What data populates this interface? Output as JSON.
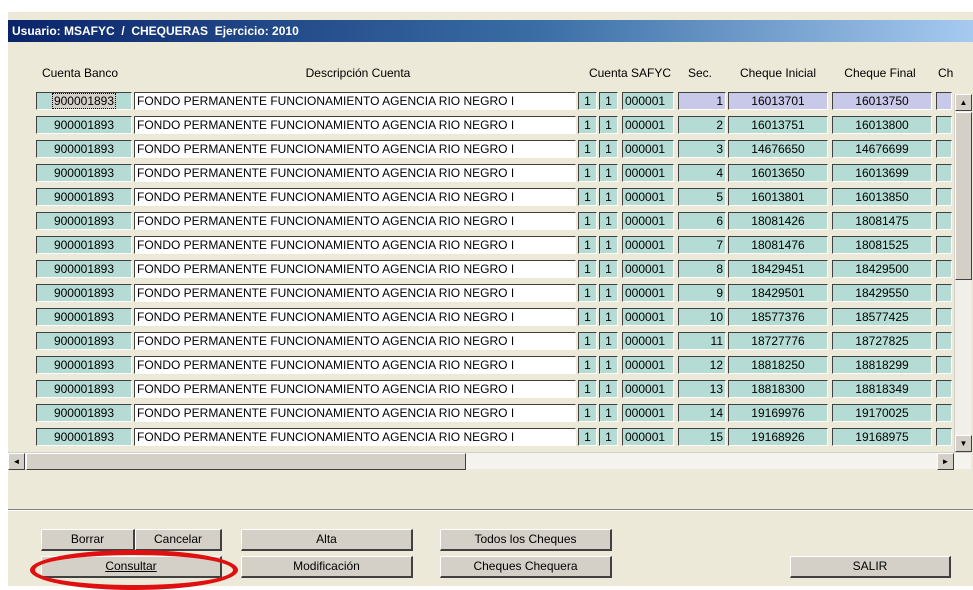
{
  "window": {
    "title": "Usuario: MSAFYC  /  CHEQUERAS  Ejercicio: 2010"
  },
  "columns": {
    "cuenta_banco": "Cuenta Banco",
    "descripcion": "Descripción Cuenta",
    "cuenta_safyc": "Cuenta SAFYC",
    "sec": "Sec.",
    "cheque_inicial": "Cheque Inicial",
    "cheque_final": "Cheque Final",
    "extra": "Ch"
  },
  "rows": [
    {
      "banco": "900001893",
      "desc": "FONDO PERMANENTE FUNCIONAMIENTO AGENCIA RIO NEGRO I",
      "n1": "1",
      "n2": "1",
      "safyc": "000001",
      "sec": "1",
      "ini": "16013701",
      "fin": "16013750"
    },
    {
      "banco": "900001893",
      "desc": "FONDO PERMANENTE FUNCIONAMIENTO AGENCIA RIO NEGRO I",
      "n1": "1",
      "n2": "1",
      "safyc": "000001",
      "sec": "2",
      "ini": "16013751",
      "fin": "16013800"
    },
    {
      "banco": "900001893",
      "desc": "FONDO PERMANENTE FUNCIONAMIENTO AGENCIA RIO NEGRO I",
      "n1": "1",
      "n2": "1",
      "safyc": "000001",
      "sec": "3",
      "ini": "14676650",
      "fin": "14676699"
    },
    {
      "banco": "900001893",
      "desc": "FONDO PERMANENTE FUNCIONAMIENTO AGENCIA RIO NEGRO I",
      "n1": "1",
      "n2": "1",
      "safyc": "000001",
      "sec": "4",
      "ini": "16013650",
      "fin": "16013699"
    },
    {
      "banco": "900001893",
      "desc": "FONDO PERMANENTE FUNCIONAMIENTO AGENCIA RIO NEGRO I",
      "n1": "1",
      "n2": "1",
      "safyc": "000001",
      "sec": "5",
      "ini": "16013801",
      "fin": "16013850"
    },
    {
      "banco": "900001893",
      "desc": "FONDO PERMANENTE FUNCIONAMIENTO AGENCIA RIO NEGRO I",
      "n1": "1",
      "n2": "1",
      "safyc": "000001",
      "sec": "6",
      "ini": "18081426",
      "fin": "18081475"
    },
    {
      "banco": "900001893",
      "desc": "FONDO PERMANENTE FUNCIONAMIENTO AGENCIA RIO NEGRO I",
      "n1": "1",
      "n2": "1",
      "safyc": "000001",
      "sec": "7",
      "ini": "18081476",
      "fin": "18081525"
    },
    {
      "banco": "900001893",
      "desc": "FONDO PERMANENTE FUNCIONAMIENTO AGENCIA RIO NEGRO I",
      "n1": "1",
      "n2": "1",
      "safyc": "000001",
      "sec": "8",
      "ini": "18429451",
      "fin": "18429500"
    },
    {
      "banco": "900001893",
      "desc": "FONDO PERMANENTE FUNCIONAMIENTO AGENCIA RIO NEGRO I",
      "n1": "1",
      "n2": "1",
      "safyc": "000001",
      "sec": "9",
      "ini": "18429501",
      "fin": "18429550"
    },
    {
      "banco": "900001893",
      "desc": "FONDO PERMANENTE FUNCIONAMIENTO AGENCIA RIO NEGRO I",
      "n1": "1",
      "n2": "1",
      "safyc": "000001",
      "sec": "10",
      "ini": "18577376",
      "fin": "18577425"
    },
    {
      "banco": "900001893",
      "desc": "FONDO PERMANENTE FUNCIONAMIENTO AGENCIA RIO NEGRO I",
      "n1": "1",
      "n2": "1",
      "safyc": "000001",
      "sec": "11",
      "ini": "18727776",
      "fin": "18727825"
    },
    {
      "banco": "900001893",
      "desc": "FONDO PERMANENTE FUNCIONAMIENTO AGENCIA RIO NEGRO I",
      "n1": "1",
      "n2": "1",
      "safyc": "000001",
      "sec": "12",
      "ini": "18818250",
      "fin": "18818299"
    },
    {
      "banco": "900001893",
      "desc": "FONDO PERMANENTE FUNCIONAMIENTO AGENCIA RIO NEGRO I",
      "n1": "1",
      "n2": "1",
      "safyc": "000001",
      "sec": "13",
      "ini": "18818300",
      "fin": "18818349"
    },
    {
      "banco": "900001893",
      "desc": "FONDO PERMANENTE FUNCIONAMIENTO AGENCIA RIO NEGRO I",
      "n1": "1",
      "n2": "1",
      "safyc": "000001",
      "sec": "14",
      "ini": "19169976",
      "fin": "19170025"
    },
    {
      "banco": "900001893",
      "desc": "FONDO PERMANENTE FUNCIONAMIENTO AGENCIA RIO NEGRO I",
      "n1": "1",
      "n2": "1",
      "safyc": "000001",
      "sec": "15",
      "ini": "19168926",
      "fin": "19168975"
    }
  ],
  "selected_row": 1,
  "scroll_icons": {
    "up": "▲",
    "down": "▼",
    "left": "◄",
    "right": "►"
  },
  "buttons": {
    "borrar": "Borrar",
    "cancelar": "Cancelar",
    "consultar": "Consultar",
    "alta": "Alta",
    "modificacion": "Modificación",
    "todos_cheques": "Todos los Cheques",
    "cheques_chequera": "Cheques Chequera",
    "salir": "SALIR"
  },
  "colors": {
    "title_start": "#0a246a",
    "title_end": "#a6caf0",
    "cell_teal": "#b5dcd4",
    "window_bg": "#ece9d8",
    "highlight_red": "#e01010"
  }
}
